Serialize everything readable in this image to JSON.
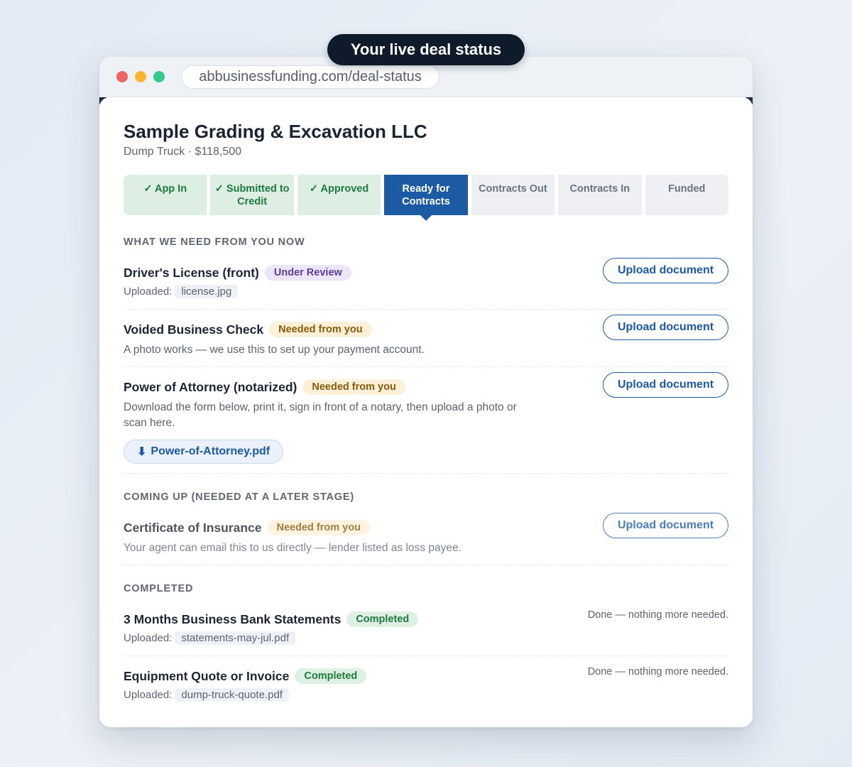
{
  "banner": {
    "text": "Your live deal status"
  },
  "browser": {
    "url": "abbusinessfunding.com/deal-status"
  },
  "deal": {
    "company": "Sample Grading & Excavation LLC",
    "subline": "Dump Truck · $118,500"
  },
  "steps": [
    {
      "label": "✓ App In",
      "state": "done"
    },
    {
      "label": "✓ Submitted to Credit",
      "state": "done"
    },
    {
      "label": "✓ Approved",
      "state": "done"
    },
    {
      "label": "Ready for Contracts",
      "state": "active"
    },
    {
      "label": "Contracts Out",
      "state": "todo"
    },
    {
      "label": "Contracts In",
      "state": "todo"
    },
    {
      "label": "Funded",
      "state": "todo"
    }
  ],
  "sections": {
    "now": "WHAT WE NEED FROM YOU NOW",
    "later": "COMING UP (NEEDED AT A LATER STAGE)",
    "completed": "COMPLETED"
  },
  "labels": {
    "uploaded": "Uploaded:",
    "upload_button": "Upload document",
    "done_note": "Done — nothing more needed."
  },
  "items": {
    "license": {
      "title": "Driver's License (front)",
      "badge": "Under Review",
      "file": "license.jpg"
    },
    "check": {
      "title": "Voided Business Check",
      "badge": "Needed from you",
      "desc": "A photo works — we use this to set up your payment account."
    },
    "poa": {
      "title": "Power of Attorney (notarized)",
      "badge": "Needed from you",
      "desc": "Download the form below, print it, sign in front of a notary, then upload a photo or scan here.",
      "download_icon": "⬇",
      "download_label": "Power-of-Attorney.pdf"
    },
    "insurance": {
      "title": "Certificate of Insurance",
      "badge": "Needed from you",
      "desc": "Your agent can email this to us directly — lender listed as loss payee."
    },
    "statements": {
      "title": "3 Months Business Bank Statements",
      "badge": "Completed",
      "file": "statements-may-jul.pdf"
    },
    "quote": {
      "title": "Equipment Quote or Invoice",
      "badge": "Completed",
      "file": "dump-truck-quote.pdf"
    }
  },
  "colors": {
    "primary": "#1c5aa3",
    "done_step": "#dcefe2",
    "banner_bg": "#0f1b2b"
  }
}
